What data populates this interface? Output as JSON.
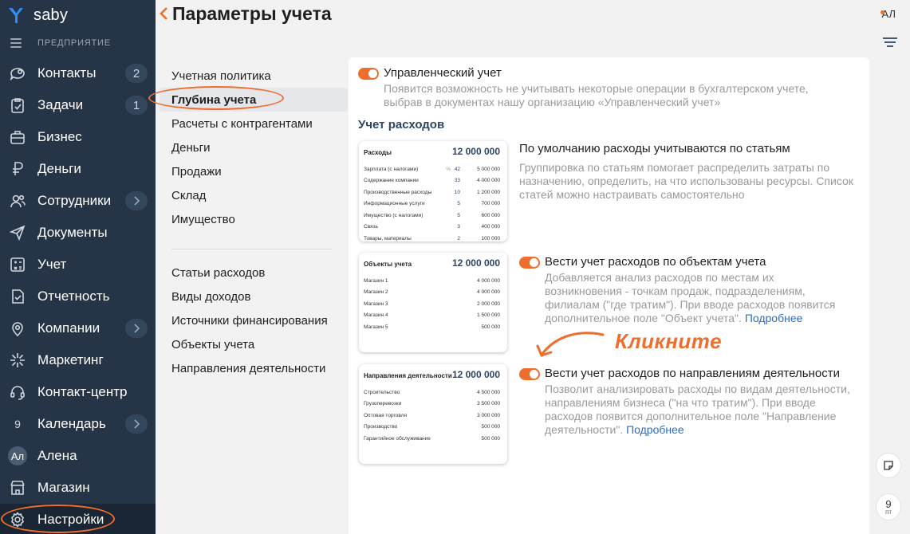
{
  "app": {
    "logo_text": "saby",
    "company_label": "ПРЕДПРИЯТИЕ"
  },
  "sidebar": {
    "items": [
      {
        "label": "Контакты",
        "icon": "contacts-icon",
        "badge": "2"
      },
      {
        "label": "Задачи",
        "icon": "tasks-icon",
        "badge": "1"
      },
      {
        "label": "Бизнес",
        "icon": "business-icon"
      },
      {
        "label": "Деньги",
        "icon": "money-icon"
      },
      {
        "label": "Сотрудники",
        "icon": "employees-icon",
        "chevron": true
      },
      {
        "label": "Документы",
        "icon": "documents-icon"
      },
      {
        "label": "Учет",
        "icon": "accounting-icon"
      },
      {
        "label": "Отчетность",
        "icon": "reports-icon"
      },
      {
        "label": "Компании",
        "icon": "companies-icon",
        "chevron": true
      },
      {
        "label": "Маркетинг",
        "icon": "marketing-icon"
      },
      {
        "label": "Контакт-центр",
        "icon": "contact-center-icon"
      },
      {
        "label": "Календарь",
        "icon": "calendar-icon",
        "chevron": true,
        "icon_text": "9"
      },
      {
        "label": "Алена",
        "icon": "avatar",
        "icon_text": "Ал"
      },
      {
        "label": "Магазин",
        "icon": "store-icon"
      },
      {
        "label": "Настройки",
        "icon": "settings-icon",
        "active": true
      }
    ]
  },
  "header": {
    "title": "Параметры учета",
    "user_initials": "АЛ"
  },
  "right_rail": {
    "calendar_day": "9",
    "calendar_weekday": "пт"
  },
  "settings_nav": {
    "group1": [
      "Учетная политика",
      "Глубина учета",
      "Расчеты с контрагентами",
      "Деньги",
      "Продажи",
      "Склад",
      "Имущество"
    ],
    "group2": [
      "Статьи расходов",
      "Виды доходов",
      "Источники финансирования",
      "Объекты учета",
      "Направления деятельности"
    ],
    "active": "Глубина учета"
  },
  "main": {
    "management": {
      "title": "Управленческий учет",
      "desc": "Появится возможность не учитывать некоторые операции в бухгалтерском учете, выбрав в документах нашу организацию «Управленческий учет»"
    },
    "section_title": "Учет расходов",
    "option_items": {
      "title": "По умолчанию расходы учитываются по статьям",
      "desc": "Группировка по статьям помогает распределить затраты по назначению, определить, на что использованы ресурсы. Список статей можно настраивать самостоятельно"
    },
    "option_objects": {
      "title": "Вести учет расходов по объектам учета",
      "desc": "Добавляется анализ расходов по местам их возникновения - точкам продаж, подразделениям, филиалам (\"где тратим\"). При вводе расходов появится дополнительное поле \"Объект учета\".",
      "link": "Подробнее"
    },
    "option_directions": {
      "title": "Вести учет расходов по направлениям деятельности",
      "desc": "Позволит анализировать расходы по видам деятельности, направлениям бизнеса (\"на что тратим\"). При вводе расходов появится дополнительное поле \"Направление деятельности\".",
      "link": "Подробнее"
    },
    "annotation": "Кликните"
  },
  "cards": {
    "expenses": {
      "title": "Расходы",
      "total": "12 000 000",
      "rows": [
        {
          "name": "Зарплата (с налогами)",
          "pct": "%",
          "cnt": "42",
          "val": "5 000 000"
        },
        {
          "name": "Содержание компании",
          "cnt": "33",
          "val": "4 000 000"
        },
        {
          "name": "Производственные расходы",
          "cnt": "10",
          "val": "1 200 000"
        },
        {
          "name": "Информационные услуги",
          "cnt": "5",
          "val": "700 000"
        },
        {
          "name": "Имущество (с налогами)",
          "cnt": "5",
          "val": "600 000"
        },
        {
          "name": "Связь",
          "cnt": "3",
          "val": "400 000"
        },
        {
          "name": "Товары, материалы",
          "cnt": "2",
          "val": "100 000"
        }
      ]
    },
    "objects": {
      "title": "Объекты учета",
      "total": "12 000 000",
      "rows": [
        {
          "name": "Магазин 1",
          "val": "4 000 000"
        },
        {
          "name": "Магазин 2",
          "val": "4 000 000"
        },
        {
          "name": "Магазин 3",
          "val": "2 000 000"
        },
        {
          "name": "Магазин 4",
          "val": "1 500 000"
        },
        {
          "name": "Магазин 5",
          "val": "500 000"
        }
      ]
    },
    "directions": {
      "title": "Направления деятельности",
      "total": "12 000 000",
      "rows": [
        {
          "name": "Строительство",
          "val": "4 500 000"
        },
        {
          "name": "Грузоперевозки",
          "val": "3 500 000"
        },
        {
          "name": "Оптовая торговля",
          "val": "3 000 000"
        },
        {
          "name": "Производство",
          "val": "500 000"
        },
        {
          "name": "Гарантийное обслуживание",
          "val": "500 000"
        }
      ]
    }
  },
  "colors": {
    "sidebar_bg": "#253446",
    "accent": "#ee6e2d",
    "link": "#2a6cc4",
    "heading": "#2d4463"
  }
}
